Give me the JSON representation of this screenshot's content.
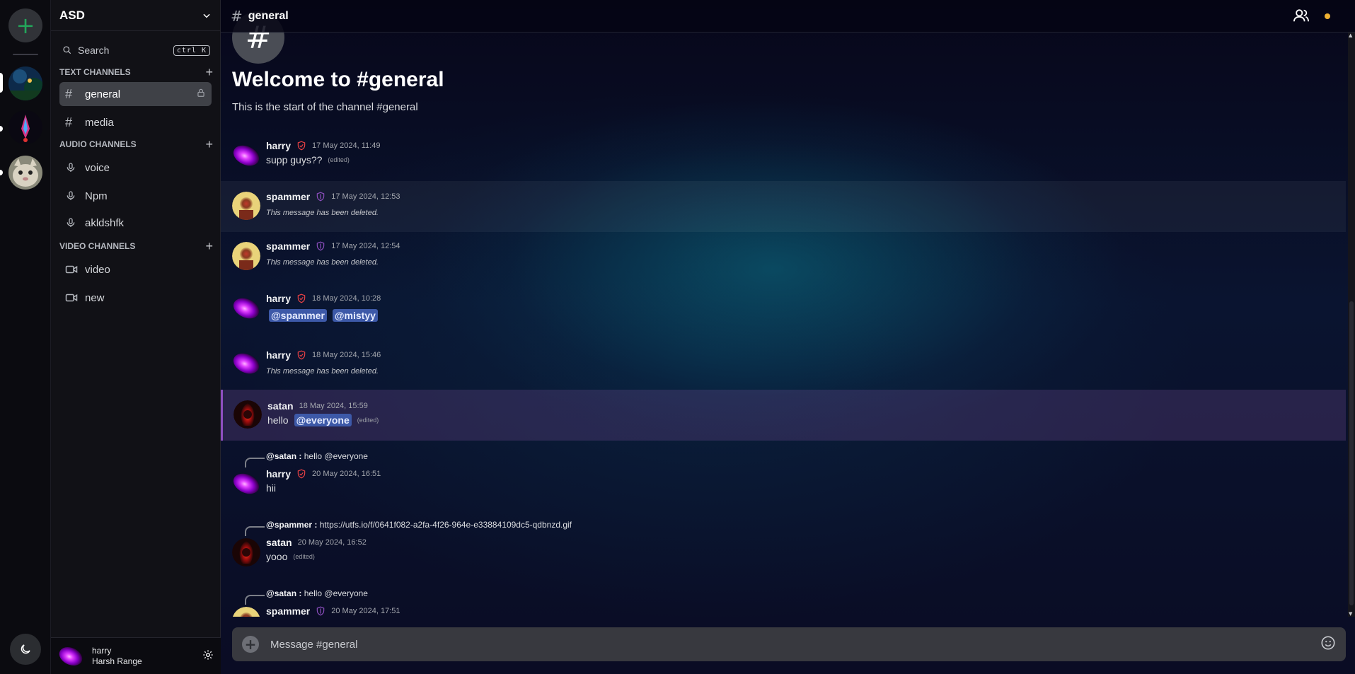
{
  "server": {
    "name": "ASD"
  },
  "search": {
    "label": "Search",
    "shortcut": "ctrl K"
  },
  "sections": {
    "text": "TEXT CHANNELS",
    "audio": "AUDIO CHANNELS",
    "video": "VIDEO CHANNELS"
  },
  "channels": {
    "text": [
      "general",
      "media"
    ],
    "audio": [
      "voice",
      "Npm",
      "akldshfk"
    ],
    "video": [
      "video",
      "new"
    ]
  },
  "user": {
    "display_name": "harry",
    "full_name": "Harsh Range"
  },
  "header": {
    "channel": "general"
  },
  "welcome": {
    "title": "Welcome to #general",
    "subtitle": "This is the start of the channel #general"
  },
  "messages": [
    {
      "user": "harry",
      "time": "17 May 2024, 11:49",
      "text": "supp guys??",
      "edited": "(edited)"
    },
    {
      "user": "spammer",
      "time": "17 May 2024, 12:53",
      "text": "This message has been deleted."
    },
    {
      "user": "spammer",
      "time": "17 May 2024, 12:54",
      "text": "This message has been deleted."
    },
    {
      "user": "harry",
      "time": "18 May 2024, 10:28",
      "mentions": [
        "@spammer",
        "@mistyy"
      ]
    },
    {
      "user": "harry",
      "time": "18 May 2024, 15:46",
      "text": "This message has been deleted."
    },
    {
      "user": "satan",
      "time": "18 May 2024, 15:59",
      "text": "hello",
      "mention": "@everyone",
      "edited": "(edited)"
    },
    {
      "reply_user": "@satan :",
      "reply_text": "hello @everyone",
      "user": "harry",
      "time": "20 May 2024, 16:51",
      "text": "hii"
    },
    {
      "reply_user": "@spammer :",
      "reply_text": "https://utfs.io/f/0641f082-a2fa-4f26-964e-e33884109dc5-qdbnzd.gif",
      "user": "satan",
      "time": "20 May 2024, 16:52",
      "text": "yooo",
      "edited": "(edited)"
    },
    {
      "reply_user": "@satan :",
      "reply_text": "hello @everyone",
      "user": "spammer",
      "time": "20 May 2024, 17:51"
    }
  ],
  "composer": {
    "placeholder": "Message #general"
  },
  "colors": {
    "accent_green": "#23a55a",
    "admin_badge": "#ed4245",
    "mod_badge": "#8e4fc0",
    "mention_bg": "#3d59a8",
    "status_idle": "#f0b232"
  }
}
